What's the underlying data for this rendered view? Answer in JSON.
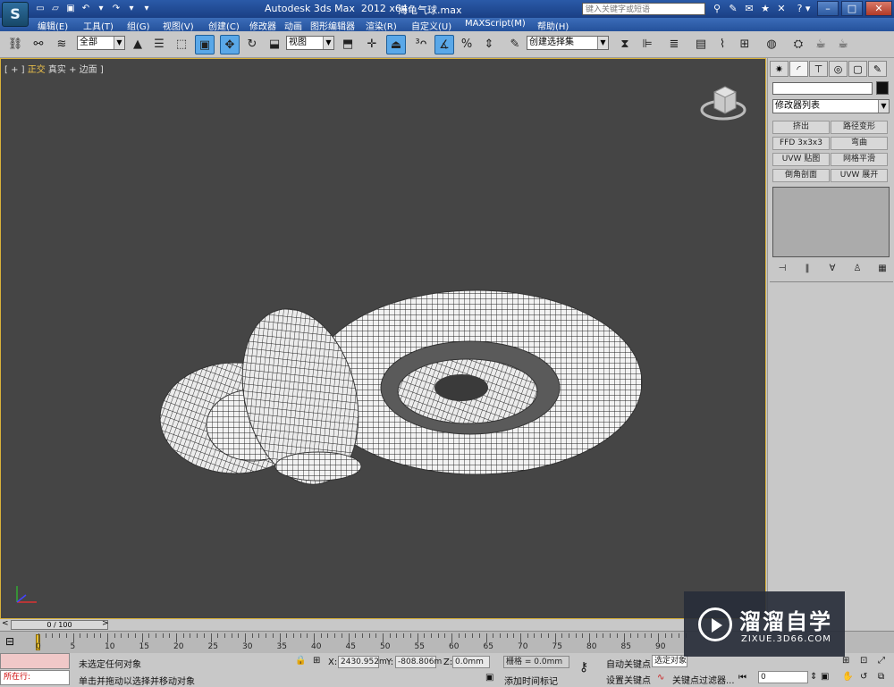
{
  "app": {
    "title_app": "Autodesk 3ds Max  2012 x64",
    "title_file": "海龟气球.max",
    "search_placeholder": "键入关键字或短语"
  },
  "menu": [
    "编辑(E)",
    "工具(T)",
    "组(G)",
    "视图(V)",
    "创建(C)",
    "修改器",
    "动画",
    "图形编辑器",
    "渲染(R)",
    "自定义(U)",
    "MAXScript(M)",
    "帮助(H)"
  ],
  "toolbar": {
    "selection_filter": "全部",
    "ref_coord": "视图",
    "selection_set": "创建选择集"
  },
  "viewport": {
    "label_prefix": "[ + ]",
    "label_view": "正交",
    "label_mode": "真实 + 边面 ]"
  },
  "command_panel": {
    "modifier_list": "修改器列表",
    "modifier_buttons": [
      "挤出",
      "路径变形",
      "FFD 3x3x3",
      "弯曲",
      "UVW 贴图",
      "网格平滑",
      "倒角剖面",
      "UVW 展开"
    ]
  },
  "timeline": {
    "frame_range": "0 / 100",
    "ticks": [
      "0",
      "5",
      "10",
      "15",
      "20",
      "25",
      "30",
      "35",
      "40",
      "45",
      "50",
      "55",
      "60",
      "65",
      "70",
      "75",
      "80",
      "85",
      "90"
    ]
  },
  "status": {
    "running_label": "所在行:",
    "selection_status": "未选定任何对象",
    "prompt": "单击并拖动以选择并移动对象",
    "x_label": "X:",
    "x_value": "2430.952m",
    "y_label": "Y:",
    "y_value": "-808.806m",
    "z_label": "Z:",
    "z_value": "0.0mm",
    "grid": "栅格 = 0.0mm",
    "add_time_tag": "添加时间标记",
    "auto_key": "自动关键点",
    "selected_objects": "选定对象",
    "set_key": "设置关键点",
    "key_filters": "关键点过滤器...",
    "current_frame": "0"
  },
  "watermark": {
    "cn": "溜溜自学",
    "en": "ZIXUE.3D66.COM"
  },
  "colors": {
    "viewport_bg": "#454545",
    "viewport_border": "#d9b23a",
    "titlebar": "#1a3f84"
  }
}
